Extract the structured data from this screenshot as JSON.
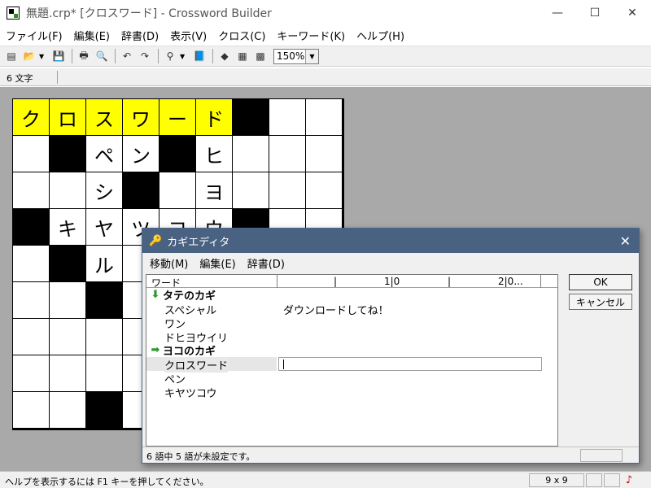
{
  "window": {
    "title": "無題.crp* [クロスワード] - Crossword Builder",
    "controls": [
      "—",
      "☐",
      "✕"
    ]
  },
  "menu": [
    "ファイル(F)",
    "編集(E)",
    "辞書(D)",
    "表示(V)",
    "クロス(C)",
    "キーワード(K)",
    "ヘルプ(H)"
  ],
  "toolbar": {
    "buttons": [
      {
        "name": "new-icon",
        "glyph": "▤"
      },
      {
        "name": "open-icon",
        "glyph": "📂"
      },
      {
        "name": "save-icon",
        "glyph": "💾"
      },
      {
        "name": "print-icon",
        "glyph": "🖶"
      },
      {
        "name": "print-preview-icon",
        "glyph": "🔍"
      },
      {
        "name": "undo-icon",
        "glyph": "↶"
      },
      {
        "name": "redo-icon",
        "glyph": "↷"
      },
      {
        "name": "find-icon",
        "glyph": "⚲"
      },
      {
        "name": "dictionary-icon",
        "glyph": "📘"
      },
      {
        "name": "eraser-icon",
        "glyph": "◆"
      },
      {
        "name": "check-icon",
        "glyph": "▦"
      },
      {
        "name": "grid-icon",
        "glyph": "▩"
      }
    ],
    "zoom": "150%"
  },
  "char_count": "6 文字",
  "grid": {
    "rows": [
      [
        "ク",
        "ロ",
        "ス",
        "ワ",
        "ー",
        "ド",
        "#",
        "",
        ""
      ],
      [
        "",
        "#",
        "ペ",
        "ン",
        "#",
        "ヒ",
        "",
        "",
        ""
      ],
      [
        "",
        "",
        "シ",
        "#",
        "",
        "ヨ",
        "",
        "",
        ""
      ],
      [
        "#",
        "キ",
        "ヤ",
        "ツ",
        "コ",
        "ウ",
        "#",
        "",
        ""
      ],
      [
        "",
        "#",
        "ル",
        "",
        "",
        "",
        "",
        "",
        ""
      ],
      [
        "",
        "",
        "#",
        "",
        "",
        "",
        "",
        "",
        ""
      ],
      [
        "",
        "",
        "",
        "",
        "",
        "",
        "",
        "",
        ""
      ],
      [
        "",
        "",
        "",
        "",
        "",
        "",
        "",
        "",
        ""
      ],
      [
        "",
        "",
        "#",
        "",
        "",
        "",
        "",
        "",
        ""
      ]
    ],
    "highlight_row": 0,
    "highlight_cols": [
      0,
      1,
      2,
      3,
      4,
      5
    ]
  },
  "status_bar": {
    "help": "ヘルプを表示するには F1 キーを押してください。",
    "size": "9 x 9",
    "note": "♪"
  },
  "dialog": {
    "title": "カギエディタ",
    "close": "✕",
    "menu": [
      "移動(M)",
      "編集(E)",
      "辞書(D)"
    ],
    "list_header": {
      "word": "ワード",
      "ruler1": "|",
      "ruler2": "1|0",
      "ruler3": "|",
      "ruler4": "2|0..."
    },
    "down_header": "タテのカギ",
    "across_header": "ヨコのカギ",
    "down_words": [
      {
        "word": "スペシャル",
        "hint": "ダウンロードしてね！"
      },
      {
        "word": "ワン",
        "hint": ""
      },
      {
        "word": "ドヒヨウイリ",
        "hint": ""
      }
    ],
    "across_words": [
      {
        "word": "クロスワード",
        "hint": "",
        "selected": true
      },
      {
        "word": "ペン",
        "hint": ""
      },
      {
        "word": "キヤツコウ",
        "hint": ""
      }
    ],
    "ok": "OK",
    "cancel": "キャンセル",
    "status": "6 語中 5 語が未設定です。"
  }
}
